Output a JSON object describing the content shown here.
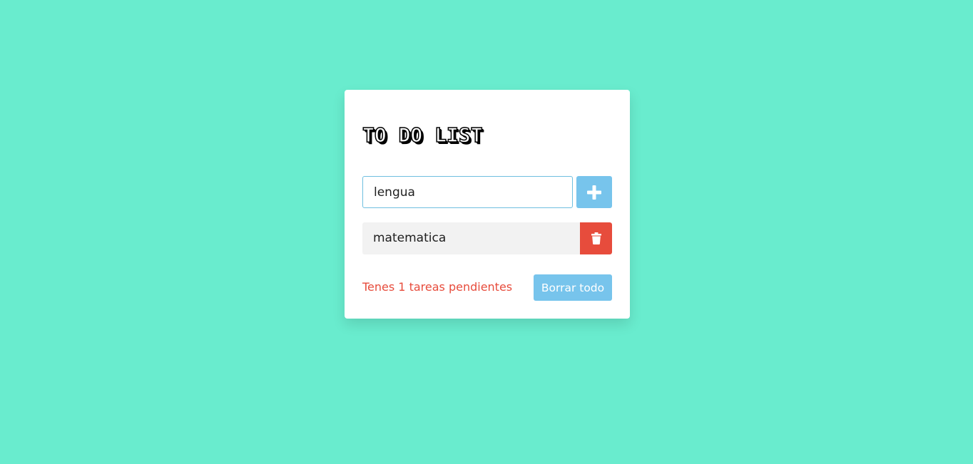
{
  "app": {
    "title": "TO DO LIST"
  },
  "input": {
    "value": "lengua",
    "placeholder": ""
  },
  "add_button": {
    "icon": "plus-icon"
  },
  "tasks": [
    {
      "text": "matematica",
      "delete_icon": "trash-icon"
    }
  ],
  "footer": {
    "pending_text": "Tenes 1 tareas pendientes",
    "clear_label": "Borrar todo"
  },
  "colors": {
    "background": "#69ecce",
    "accent": "#77c4ec",
    "danger": "#e74c3c",
    "item_background": "#f2f2f2"
  }
}
